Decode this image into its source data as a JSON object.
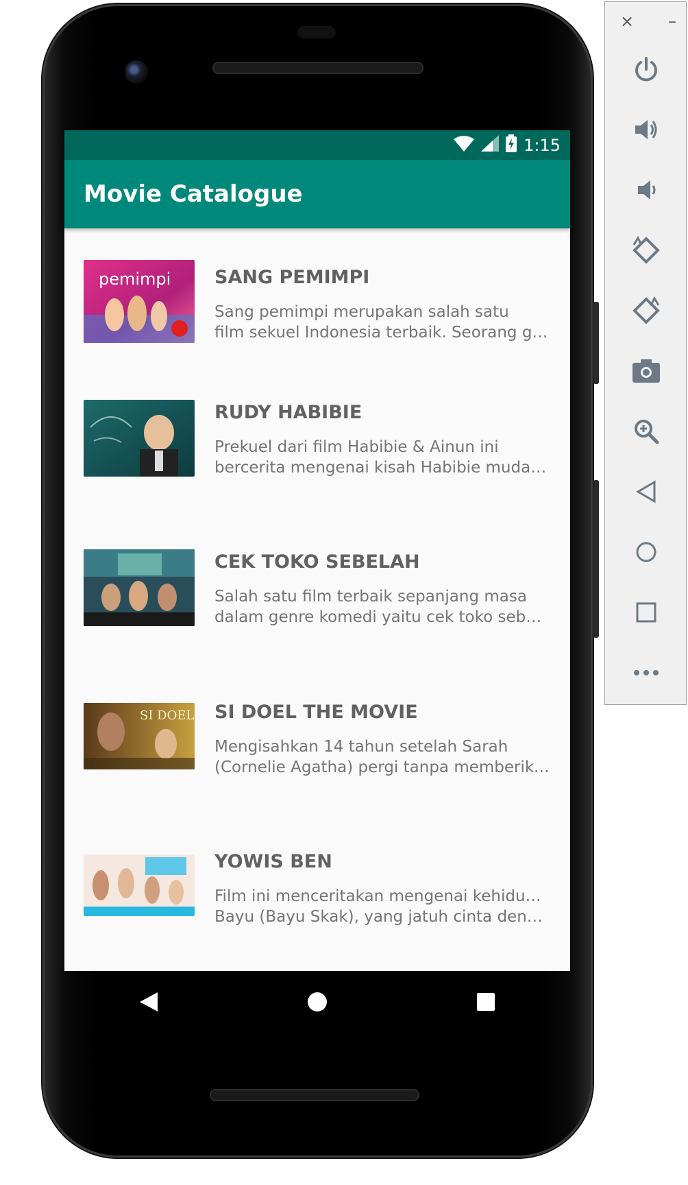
{
  "status_bar": {
    "time": "1:15"
  },
  "app_bar": {
    "title": "Movie Catalogue"
  },
  "movies": [
    {
      "title": "SANG PEMIMPI",
      "desc_line1": "Sang pemimpi merupakan salah satu",
      "desc_line2": "film sekuel Indonesia terbaik. Seorang guru yang"
    },
    {
      "title": "RUDY HABIBIE",
      "desc_line1": "Prekuel dari film Habibie & Ainun ini",
      "desc_line2": "bercerita mengenai kisah Habibie muda ja..."
    },
    {
      "title": "CEK TOKO SEBELAH",
      "desc_line1": "Salah satu film terbaik sepanjang masa",
      "desc_line2": "dalam genre komedi yaitu cek toko sebelah"
    },
    {
      "title": "SI DOEL THE MOVIE",
      "desc_line1": "Mengisahkan 14 tahun setelah Sarah",
      "desc_line2": "(Cornelie Agatha) pergi tanpa memberikan kabar"
    },
    {
      "title": "YOWIS BEN",
      "desc_line1": "Film ini menceritakan mengenai kehidupan",
      "desc_line2": "Bayu (Bayu Skak), yang jatuh cinta dengan Susan"
    }
  ],
  "poster_text": {
    "sang_pemimpi": "pemimpi",
    "si_doel": "SI DOEL"
  },
  "colors": {
    "status_bar": "#00695c",
    "app_bar": "#00897b",
    "background": "#fafafa"
  },
  "nav": {
    "back": "back-icon",
    "home": "home-icon",
    "recents": "recents-icon"
  },
  "emulator_toolbar": {
    "close": "×",
    "minimize": "–",
    "buttons": [
      "power-icon",
      "volume-up-icon",
      "volume-down-icon",
      "rotate-left-icon",
      "rotate-right-icon",
      "camera-icon",
      "zoom-icon",
      "back-icon",
      "home-icon",
      "overview-icon",
      "more-icon"
    ]
  }
}
